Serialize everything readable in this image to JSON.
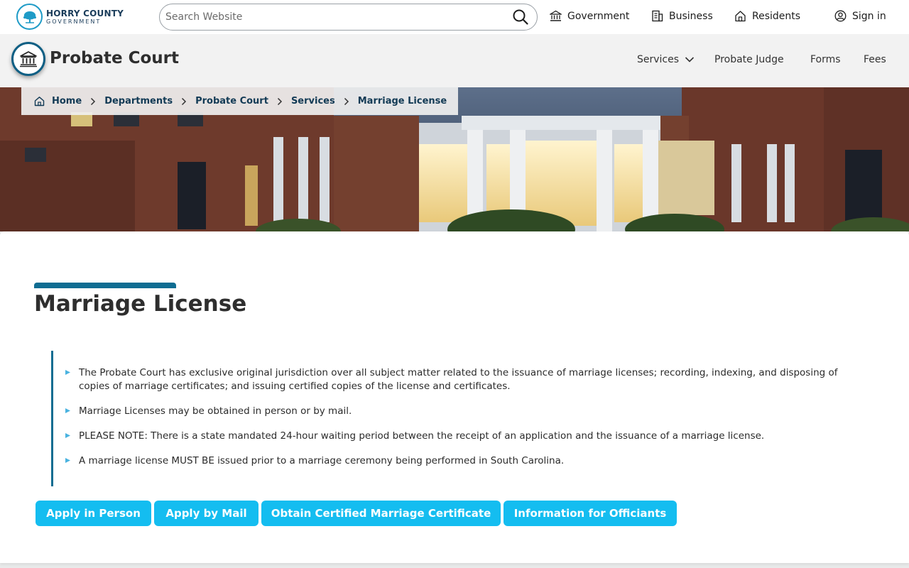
{
  "site": {
    "logo_line1": "HORRY COUNTY",
    "logo_line2": "GOVERNMENT"
  },
  "search": {
    "placeholder": "Search Website",
    "value": ""
  },
  "topnav": {
    "government": "Government",
    "business": "Business",
    "residents": "Residents",
    "signin": "Sign in"
  },
  "department": {
    "title": "Probate Court",
    "nav": {
      "services": "Services",
      "judge": "Probate Judge",
      "forms": "Forms",
      "fees": "Fees"
    }
  },
  "breadcrumb": {
    "home": "Home",
    "departments": "Departments",
    "probate": "Probate Court",
    "services": "Services",
    "current": "Marriage License"
  },
  "page": {
    "title": "Marriage License",
    "notes": [
      "The Probate Court has exclusive original jurisdiction over all subject matter related to the issuance of marriage licenses; recording, indexing, and disposing of copies of marriage certificates; and issuing certified copies of the license and certificates.",
      "Marriage Licenses may be obtained in person or by mail.",
      "PLEASE NOTE: There is a state mandated 24-hour waiting period between the receipt of an application and the issuance of a marriage license.",
      "A marriage license MUST BE issued prior to a marriage ceremony being performed in South Carolina."
    ],
    "buttons": {
      "in_person": "Apply in Person",
      "by_mail": "Apply by Mail",
      "certificate": "Obtain Certified Marriage Certificate",
      "officiants": "Information for Officiants"
    }
  },
  "colors": {
    "accent": "#0f6d92",
    "button": "#14bdf0",
    "bullet": "#4ab3e0",
    "heading": "#2e2e2e"
  }
}
